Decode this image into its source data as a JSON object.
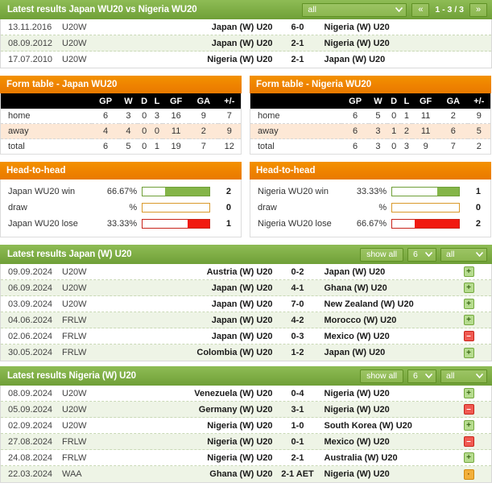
{
  "h2h_results": {
    "title": "Latest results Japan WU20 vs Nigeria WU20",
    "filter_label": "all",
    "prev_label": "«",
    "next_label": "»",
    "page_label": "1 - 3 / 3",
    "rows": [
      {
        "date": "13.11.2016",
        "comp": "U20W",
        "home": "Japan (W) U20",
        "score": "6-0",
        "away": "Nigeria (W) U20"
      },
      {
        "date": "08.09.2012",
        "comp": "U20W",
        "home": "Japan (W) U20",
        "score": "2-1",
        "away": "Nigeria (W) U20"
      },
      {
        "date": "17.07.2010",
        "comp": "U20W",
        "home": "Nigeria (W) U20",
        "score": "2-1",
        "away": "Japan (W) U20"
      }
    ]
  },
  "form_tables": [
    {
      "title": "Form table - Japan WU20",
      "columns": [
        "",
        "GP",
        "W",
        "D",
        "L",
        "GF",
        "GA",
        "+/-"
      ],
      "rows": [
        {
          "label": "home",
          "values": [
            "6",
            "3",
            "0",
            "3",
            "16",
            "9",
            "7"
          ]
        },
        {
          "label": "away",
          "values": [
            "4",
            "4",
            "0",
            "0",
            "11",
            "2",
            "9"
          ]
        },
        {
          "label": "total",
          "values": [
            "6",
            "5",
            "0",
            "1",
            "19",
            "7",
            "12"
          ]
        }
      ]
    },
    {
      "title": "Form table - Nigeria WU20",
      "columns": [
        "",
        "GP",
        "W",
        "D",
        "L",
        "GF",
        "GA",
        "+/-"
      ],
      "rows": [
        {
          "label": "home",
          "values": [
            "6",
            "5",
            "0",
            "1",
            "11",
            "2",
            "9"
          ]
        },
        {
          "label": "away",
          "values": [
            "6",
            "3",
            "1",
            "2",
            "11",
            "6",
            "5"
          ]
        },
        {
          "label": "total",
          "values": [
            "6",
            "3",
            "0",
            "3",
            "9",
            "7",
            "2"
          ]
        }
      ]
    }
  ],
  "head_to_head": [
    {
      "title": "Head-to-head",
      "rows": [
        {
          "label": "Japan WU20 win",
          "pct": "66.67%",
          "pct_value": 66.67,
          "count": "2",
          "kind": "win"
        },
        {
          "label": "draw",
          "pct": "%",
          "pct_value": 0,
          "count": "0",
          "kind": "draw"
        },
        {
          "label": "Japan WU20 lose",
          "pct": "33.33%",
          "pct_value": 33.33,
          "count": "1",
          "kind": "lose"
        }
      ]
    },
    {
      "title": "Head-to-head",
      "rows": [
        {
          "label": "Nigeria WU20 win",
          "pct": "33.33%",
          "pct_value": 33.33,
          "count": "1",
          "kind": "win"
        },
        {
          "label": "draw",
          "pct": "%",
          "pct_value": 0,
          "count": "0",
          "kind": "draw"
        },
        {
          "label": "Nigeria WU20 lose",
          "pct": "66.67%",
          "pct_value": 66.67,
          "count": "2",
          "kind": "lose"
        }
      ]
    }
  ],
  "latest_japan": {
    "title": "Latest results Japan (W) U20",
    "show_all_label": "show all",
    "count_label": "6",
    "filter_label": "all",
    "rows": [
      {
        "date": "09.09.2024",
        "comp": "U20W",
        "home": "Austria (W) U20",
        "score": "0-2",
        "away": "Japan (W) U20",
        "result": "win"
      },
      {
        "date": "06.09.2024",
        "comp": "U20W",
        "home": "Japan (W) U20",
        "score": "4-1",
        "away": "Ghana (W) U20",
        "result": "win"
      },
      {
        "date": "03.09.2024",
        "comp": "U20W",
        "home": "Japan (W) U20",
        "score": "7-0",
        "away": "New Zealand (W) U20",
        "result": "win"
      },
      {
        "date": "04.06.2024",
        "comp": "FRLW",
        "home": "Japan (W) U20",
        "score": "4-2",
        "away": "Morocco (W) U20",
        "result": "win"
      },
      {
        "date": "02.06.2024",
        "comp": "FRLW",
        "home": "Japan (W) U20",
        "score": "0-3",
        "away": "Mexico (W) U20",
        "result": "lose"
      },
      {
        "date": "30.05.2024",
        "comp": "FRLW",
        "home": "Colombia (W) U20",
        "score": "1-2",
        "away": "Japan (W) U20",
        "result": "win"
      }
    ]
  },
  "latest_nigeria": {
    "title": "Latest results Nigeria (W) U20",
    "show_all_label": "show all",
    "count_label": "6",
    "filter_label": "all",
    "rows": [
      {
        "date": "08.09.2024",
        "comp": "U20W",
        "home": "Venezuela (W) U20",
        "score": "0-4",
        "away": "Nigeria (W) U20",
        "result": "win"
      },
      {
        "date": "05.09.2024",
        "comp": "U20W",
        "home": "Germany (W) U20",
        "score": "3-1",
        "away": "Nigeria (W) U20",
        "result": "lose"
      },
      {
        "date": "02.09.2024",
        "comp": "U20W",
        "home": "Nigeria (W) U20",
        "score": "1-0",
        "away": "South Korea (W) U20",
        "result": "win"
      },
      {
        "date": "27.08.2024",
        "comp": "FRLW",
        "home": "Nigeria (W) U20",
        "score": "0-1",
        "away": "Mexico (W) U20",
        "result": "lose"
      },
      {
        "date": "24.08.2024",
        "comp": "FRLW",
        "home": "Nigeria (W) U20",
        "score": "2-1",
        "away": "Australia (W) U20",
        "result": "win"
      },
      {
        "date": "22.03.2024",
        "comp": "WAA",
        "home": "Ghana (W) U20",
        "score": "2-1 AET",
        "away": "Nigeria (W) U20",
        "result": "draw"
      }
    ]
  },
  "icons": {
    "chevron_down": "⌄",
    "win": "+",
    "lose": "–",
    "draw": "·"
  },
  "colors": {
    "green_header": "#7fae46",
    "orange_header": "#ee8100",
    "bar_green": "#84b548",
    "bar_red": "#f11a10",
    "bar_orange_border": "#d99a2b",
    "row_alt": "#eef4e6",
    "form_row_alt": "#fde8d6"
  }
}
